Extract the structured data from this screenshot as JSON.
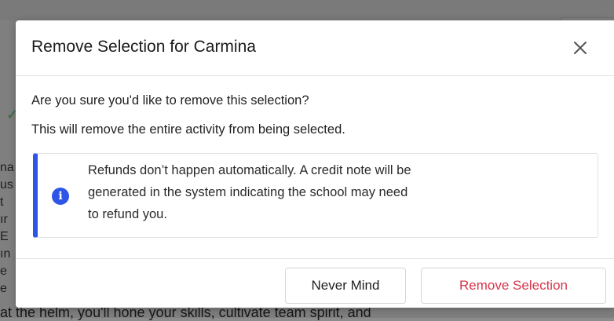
{
  "background": {
    "bottom_text": "at the helm, you'll hone your skills, cultivate team spirit, and",
    "partial_lines": [
      "na",
      "us",
      "t",
      "ır",
      "E",
      "ın",
      "e",
      "e"
    ]
  },
  "modal": {
    "title": "Remove Selection for Carmina",
    "close_icon": "close-icon",
    "question": "Are you sure you'd like to remove this selection?",
    "description": "This will remove the entire activity from being selected.",
    "alert": {
      "icon": "info-icon",
      "accent_color": "#2f55e6",
      "lines": [
        "Refunds don’t happen automatically. A credit note will be",
        "generated in the system indicating the school may need",
        "to refund you."
      ]
    },
    "buttons": {
      "never_mind": "Never Mind",
      "remove": "Remove Selection"
    },
    "remove_color": "#d8354a"
  }
}
